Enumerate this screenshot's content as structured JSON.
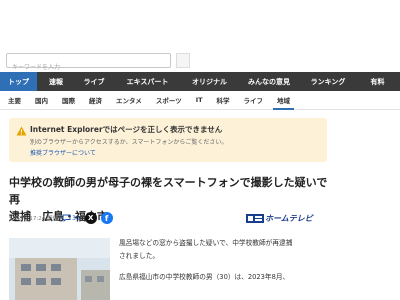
{
  "search": {
    "placeholder": "キーワードを入力"
  },
  "main_nav": {
    "items": [
      {
        "label": "トップ",
        "active": true
      },
      {
        "label": "速報",
        "active": false
      },
      {
        "label": "ライブ",
        "active": false
      },
      {
        "label": "エキスパート",
        "active": false
      },
      {
        "label": "オリジナル",
        "active": false
      },
      {
        "label": "みんなの意見",
        "active": false
      },
      {
        "label": "ランキング",
        "active": false
      },
      {
        "label": "有料",
        "active": false
      }
    ]
  },
  "sub_nav": {
    "items": [
      {
        "label": "主要",
        "active": false
      },
      {
        "label": "国内",
        "active": false
      },
      {
        "label": "国際",
        "active": false
      },
      {
        "label": "経済",
        "active": false
      },
      {
        "label": "エンタメ",
        "active": false
      },
      {
        "label": "スポーツ",
        "active": false
      },
      {
        "label": "IT",
        "active": false
      },
      {
        "label": "科学",
        "active": false
      },
      {
        "label": "ライフ",
        "active": false
      },
      {
        "label": "地域",
        "active": true
      }
    ]
  },
  "notice": {
    "title": "Internet Explorerではページを正しく表示できません",
    "sub": "別のブラウザーからアクセスするか、スマートフォンからご覧ください。",
    "link": "推奨ブラウザーについて"
  },
  "article": {
    "headline_line1": "中学校の教師の男が母子の裸をスマートフォンで撮影した疑いで再",
    "headline_line2": "逮捕　広島・福山市",
    "date": "5/8(水) 17:24 配信",
    "comment_count": "30",
    "x_icon_glyph": "X",
    "fb_icon_glyph": "f",
    "source_name": "ホームテレビ",
    "body_p1_line1": "風呂場などの窓から盗撮した疑いで、中学校教師が再逮捕",
    "body_p1_line2": "されました。",
    "body_p2_line1": "広島県福山市の中学校教師の男（30）は、2023年8月、"
  },
  "colors": {
    "nav_bg": "#3a3a3a",
    "nav_active": "#2e6fb5",
    "notice_bg": "#fdf2d8",
    "link": "#1a55b5",
    "brand": "#1a3d8f"
  }
}
